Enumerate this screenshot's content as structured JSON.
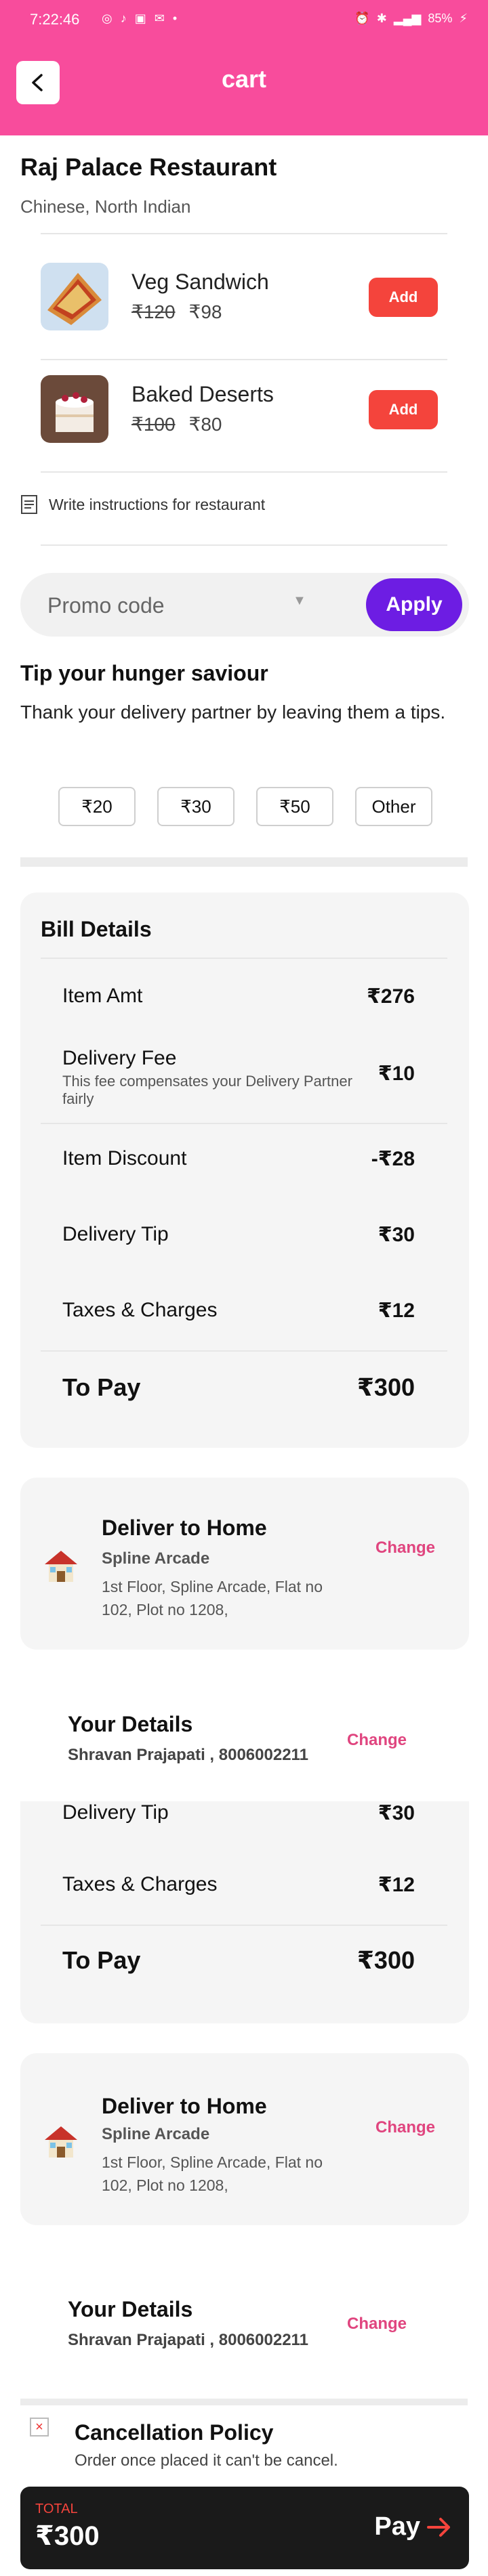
{
  "status_bar": {
    "time": "7:22:46",
    "battery": "85%"
  },
  "header": {
    "title": "cart"
  },
  "restaurant": {
    "name": "Raj Palace Restaurant",
    "cuisine": "Chinese, North Indian"
  },
  "items": [
    {
      "name": "Veg Sandwich",
      "old_price": "₹120",
      "price": "₹98",
      "action": "Add"
    },
    {
      "name": "Baked Deserts",
      "old_price": "₹100",
      "price": "₹80",
      "action": "Add"
    }
  ],
  "instructions": {
    "label": "Write instructions for restaurant"
  },
  "promo": {
    "placeholder": "Promo code",
    "apply_label": "Apply"
  },
  "tip": {
    "title": "Tip your hunger saviour",
    "description": "Thank your delivery partner by leaving them  a tips.",
    "options": [
      "₹20",
      "₹30",
      "₹50",
      "Other"
    ]
  },
  "bill": {
    "title": "Bill Details",
    "item_amt": {
      "label": "Item Amt",
      "value": "₹276"
    },
    "delivery_fee": {
      "label": "Delivery Fee",
      "sub": "This fee compensates your Delivery Partner fairly",
      "value": "₹10"
    },
    "item_discount": {
      "label": "Item Discount",
      "value": "-₹28"
    },
    "delivery_tip": {
      "label": "Delivery Tip",
      "value": "₹30"
    },
    "taxes": {
      "label": "Taxes & Charges",
      "value": "₹12"
    },
    "to_pay": {
      "label": "To Pay",
      "value": "₹300"
    }
  },
  "delivery": {
    "title": "Deliver to Home",
    "place": "Spline Arcade",
    "address": "1st Floor, Spline Arcade, Flat no 102, Plot no 1208,",
    "change_label": "Change"
  },
  "user_details": {
    "title": "Your  Details",
    "info": "Shravan Prajapati , 8006002211",
    "change_label": "Change"
  },
  "cancellation": {
    "title": "Cancellation Policy",
    "description": "Order once placed it can't be cancel."
  },
  "pay_bar": {
    "total_label": "TOTAL",
    "total_value": "₹300",
    "pay_label": "Pay"
  },
  "colors": {
    "brand_pink": "#f84c9c",
    "add_red": "#f4443c",
    "apply_purple": "#6d1de3",
    "change_pink": "#e0457f"
  }
}
